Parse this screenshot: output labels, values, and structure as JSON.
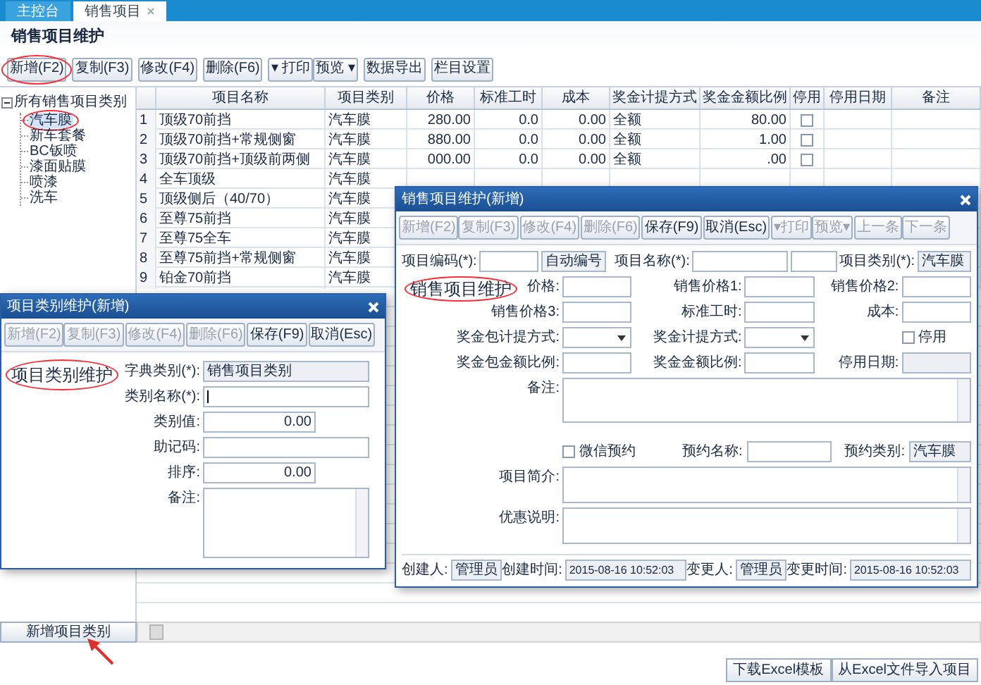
{
  "tabs": [
    {
      "label": "主控台",
      "selected": false,
      "closable": false
    },
    {
      "label": "销售项目",
      "selected": true,
      "closable": true
    }
  ],
  "page_title": "销售项目维护",
  "toolbar": [
    {
      "buttons": [
        {
          "label": "新增(F2)",
          "circled": true
        },
        {
          "label": "复制(F3)",
          "circled": false
        }
      ]
    },
    {
      "buttons": [
        {
          "label": "修改(F4)",
          "circled": false
        }
      ]
    },
    {
      "buttons": [
        {
          "label": "删除(F6)",
          "circled": false
        }
      ]
    },
    {
      "buttons": [
        {
          "label": "▾ 打印",
          "circled": false
        },
        {
          "label": "预览 ▾",
          "circled": false
        }
      ]
    },
    {
      "buttons": [
        {
          "label": "数据导出",
          "circled": false
        }
      ]
    },
    {
      "buttons": [
        {
          "label": "栏目设置",
          "circled": false
        }
      ]
    }
  ],
  "tree": {
    "label": "所有销售项目类别",
    "expanded": true,
    "children": [
      {
        "label": "汽车膜",
        "selected": true,
        "circled": true
      },
      {
        "label": "新车套餐",
        "selected": false,
        "circled": false
      },
      {
        "label": "BC钣喷",
        "selected": false,
        "circled": false
      },
      {
        "label": "漆面贴膜",
        "selected": false,
        "circled": false
      },
      {
        "label": "喷漆",
        "selected": false,
        "circled": false
      },
      {
        "label": "洗车",
        "selected": false,
        "circled": false
      }
    ]
  },
  "table": {
    "columns": [
      "项目名称",
      "项目类别",
      "价格",
      "标准工时",
      "成本",
      "奖金计提方式",
      "奖金金额比例",
      "停用",
      "停用日期",
      "备注"
    ],
    "rows": [
      {
        "number": "1",
        "cells": [
          "顶级70前挡",
          "汽车膜",
          "280.00",
          "0.0",
          "0.00",
          "全额",
          "80.00"
        ],
        "stopped": false
      },
      {
        "number": "2",
        "cells": [
          "顶级70前挡+常规侧窗",
          "汽车膜",
          "880.00",
          "0.0",
          "0.00",
          "全额",
          "1.00"
        ],
        "stopped": false
      },
      {
        "number": "3",
        "cells": [
          "顶级70前挡+顶级前两侧",
          "汽车膜",
          "000.00",
          "0.0",
          "0.00",
          "全额",
          ".00"
        ],
        "stopped": false
      },
      {
        "number": "4",
        "cells": [
          "全车顶级",
          "汽车膜"
        ]
      },
      {
        "number": "5",
        "cells": [
          "顶级侧后（40/70）",
          "汽车膜"
        ]
      },
      {
        "number": "6",
        "cells": [
          "至尊75前挡",
          "汽车膜"
        ]
      },
      {
        "number": "7",
        "cells": [
          "至尊75全车",
          "汽车膜"
        ]
      },
      {
        "number": "8",
        "cells": [
          "至尊75前挡+常规侧窗",
          "汽车膜"
        ]
      },
      {
        "number": "9",
        "cells": [
          "铂金70前挡",
          "汽车膜"
        ]
      }
    ]
  },
  "add_category_button": {
    "label": "新增项目类别",
    "arrow": true
  },
  "bottom_buttons": [
    "下载Excel模板",
    "从Excel文件导入项目"
  ],
  "category_dialog": {
    "title": "项目类别维护(新增)",
    "toolbar": [
      {
        "buttons": [
          {
            "label": "新增(F2)",
            "disabled": true
          },
          {
            "label": "复制(F3)",
            "disabled": true
          }
        ]
      },
      {
        "buttons": [
          {
            "label": "修改(F4)",
            "disabled": true
          }
        ]
      },
      {
        "buttons": [
          {
            "label": "删除(F6)",
            "disabled": true
          }
        ]
      },
      {
        "buttons": [
          {
            "label": "保存(F9)",
            "disabled": false
          }
        ]
      },
      {
        "buttons": [
          {
            "label": "取消(Esc)",
            "disabled": false
          }
        ]
      }
    ],
    "heading": "项目类别维护",
    "heading_circled": true,
    "fields": [
      {
        "label": "字典类别(*):",
        "kind": "text",
        "value": "销售项目类别",
        "readonly": true
      },
      {
        "label": "类别名称(*):",
        "kind": "text",
        "focused": true,
        "readonly": false
      },
      {
        "label": "类别值:",
        "kind": "number",
        "value": "0.00",
        "readonly": false
      },
      {
        "label": "助记码:",
        "kind": "text",
        "readonly": false
      },
      {
        "label": "排序:",
        "kind": "number",
        "value": "0.00",
        "readonly": false
      },
      {
        "label": "备注:",
        "kind": "textarea",
        "readonly": false
      }
    ]
  },
  "item_dialog": {
    "title": "销售项目维护(新增)",
    "toolbar": [
      {
        "buttons": [
          {
            "label": "新增(F2)",
            "disabled": true
          },
          {
            "label": "复制(F3)",
            "disabled": true
          }
        ]
      },
      {
        "buttons": [
          {
            "label": "修改(F4)",
            "disabled": true
          }
        ]
      },
      {
        "buttons": [
          {
            "label": "删除(F6)",
            "disabled": true
          }
        ]
      },
      {
        "buttons": [
          {
            "label": "保存(F9)",
            "disabled": false
          }
        ]
      },
      {
        "buttons": [
          {
            "label": "取消(Esc)",
            "disabled": false
          }
        ]
      },
      {
        "buttons": [
          {
            "label": "▾打印",
            "disabled": true
          },
          {
            "label": "预览▾",
            "disabled": true
          }
        ]
      },
      {
        "buttons": [
          {
            "label": "上一条",
            "disabled": true
          },
          {
            "label": "下一条",
            "disabled": true
          }
        ]
      }
    ],
    "code_label": "项目编码(*):",
    "auto_code_button": "自动编号",
    "name_label": "项目名称(*):",
    "category_label": "项目类别(*):",
    "category_value": "汽车膜",
    "heading": "销售项目维护",
    "heading_circled": true,
    "fields": [
      {
        "label": "价格:",
        "kind": "text"
      },
      {
        "label": "销售价格1:",
        "kind": "text"
      },
      {
        "label": "销售价格2:",
        "kind": "text"
      },
      {
        "label": "销售价格3:",
        "kind": "text"
      },
      {
        "label": "标准工时:",
        "kind": "text"
      },
      {
        "label": "成本:",
        "kind": "text"
      },
      {
        "label": "奖金包计提方式:",
        "kind": "select"
      },
      {
        "label": "奖金计提方式:",
        "kind": "select"
      },
      {
        "label": "停用",
        "kind": "checkbox",
        "checked": false
      },
      {
        "label": "奖金包金额比例:",
        "kind": "text"
      },
      {
        "label": "奖金金额比例:",
        "kind": "text"
      },
      {
        "label": "停用日期:",
        "kind": "readonly"
      }
    ],
    "remark_label": "备注:",
    "wechat": {
      "label": "微信预约",
      "checked": false
    },
    "booking_name_label": "预约名称:",
    "booking_category_label": "预约类别:",
    "booking_category_value": "汽车膜",
    "intro_label": "项目简介:",
    "discount_label": "优惠说明:",
    "footer": [
      {
        "label": "创建人:",
        "value": "管理员",
        "kind": "short"
      },
      {
        "label": "创建时间:",
        "value": "2015-08-16 10:52:03",
        "kind": "long"
      },
      {
        "label": "变更人:",
        "value": "管理员",
        "kind": "short"
      },
      {
        "label": "变更时间:",
        "value": "2015-08-16 10:52:03",
        "kind": "long"
      }
    ]
  }
}
